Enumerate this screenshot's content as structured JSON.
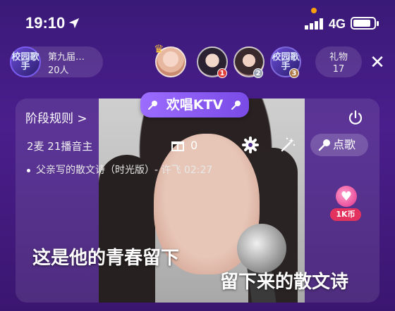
{
  "status_bar": {
    "time": "19:10",
    "network": "4G"
  },
  "room": {
    "logo_text": "校园歌手",
    "name": "第九届…",
    "count": "20人"
  },
  "top_avatars": {
    "badge1": "1",
    "badge2": "2",
    "badge3": "3",
    "logo_text": "校园歌手"
  },
  "gift_pill": {
    "label": "礼物",
    "count": "17"
  },
  "ktv": {
    "tab_label": "欢唱KTV"
  },
  "panel": {
    "rules_label": "阶段规则 >",
    "mic_info": "2麦  21播音主",
    "gift_count": "0",
    "song_button": "点歌",
    "song_line": "父亲写的散文诗（时光版）- 许飞 02:27",
    "coin_label": "1K币"
  },
  "lyrics": {
    "line1": "这是他的青春留下",
    "line2": "留下来的散文诗"
  },
  "colors": {
    "accent": "#8a5cf0",
    "coin": "#e4325e",
    "status_orange": "#ff9f0a"
  }
}
